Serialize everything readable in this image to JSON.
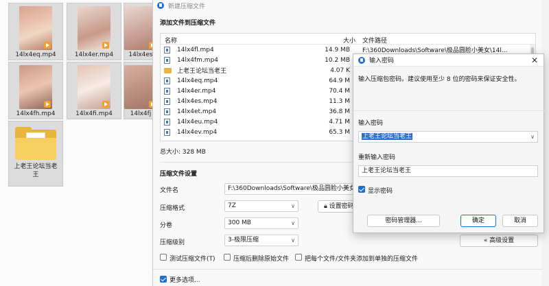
{
  "explorer": {
    "tiles": [
      {
        "label": "14lx4eq.mp4"
      },
      {
        "label": "14lx4er.mp4"
      },
      {
        "label": "14lx4es"
      },
      {
        "label": "14lx4fh.mp4"
      },
      {
        "label": "14lx4fi.mp4"
      },
      {
        "label": "14lx4fj"
      },
      {
        "label": "上老王论坛当老王"
      }
    ]
  },
  "main": {
    "title": "新建压缩文件",
    "add_section": "添加文件到压缩文件",
    "columns": {
      "name": "名称",
      "size": "大小",
      "path": "文件路径"
    },
    "files": [
      {
        "name": "14lx4fl.mp4",
        "size": "14.9 MB",
        "path": "F:\\360Downloads\\Software\\极品圆脸小美女\\14l..."
      },
      {
        "name": "14lx4fm.mp4",
        "size": "10.2 MB",
        "path": ""
      },
      {
        "name": "上老王论坛当老王",
        "size": "4.07 K",
        "path": ""
      },
      {
        "name": "14lx4eq.mp4",
        "size": "64.9 M",
        "path": ""
      },
      {
        "name": "14lx4er.mp4",
        "size": "70.4 M",
        "path": ""
      },
      {
        "name": "14lx4es.mp4",
        "size": "11.3 M",
        "path": ""
      },
      {
        "name": "14lx4et.mp4",
        "size": "36.8 M",
        "path": ""
      },
      {
        "name": "14lx4eu.mp4",
        "size": "4.71 M",
        "path": ""
      },
      {
        "name": "14lx4ev.mp4",
        "size": "65.3 M",
        "path": ""
      }
    ],
    "total": "总大小: 328 MB",
    "settings_section": "压缩文件设置",
    "filename_label": "文件名",
    "filename_value": "F:\\360Downloads\\Software\\极品圆脸小美女\\",
    "format_label": "压缩格式",
    "format_value": "7Z",
    "set_password_label": "设置密码",
    "split_label": "分卷",
    "split_value": "300 MB",
    "level_label": "压缩级别",
    "level_value": "3-极限压缩",
    "advanced_label": "« 高级设置",
    "test_label": "测试压缩文件(T)",
    "delete_label": "压缩后删除原始文件",
    "each_label": "把每个文件/文件夹添加到单独的压缩文件",
    "more_label": "更多选项..."
  },
  "password_dialog": {
    "title": "输入密码",
    "hint": "输入压缩包密码。建议使用至少 8 位的密码来保证安全性。",
    "enter_label": "输入密码",
    "enter_value": "上老王论坛当老王",
    "reenter_label": "重新输入密码",
    "reenter_value": "上老王论坛当老王",
    "show_label": "显示密码",
    "manager_label": "密码管理器...",
    "ok_label": "确定",
    "cancel_label": "取消"
  }
}
